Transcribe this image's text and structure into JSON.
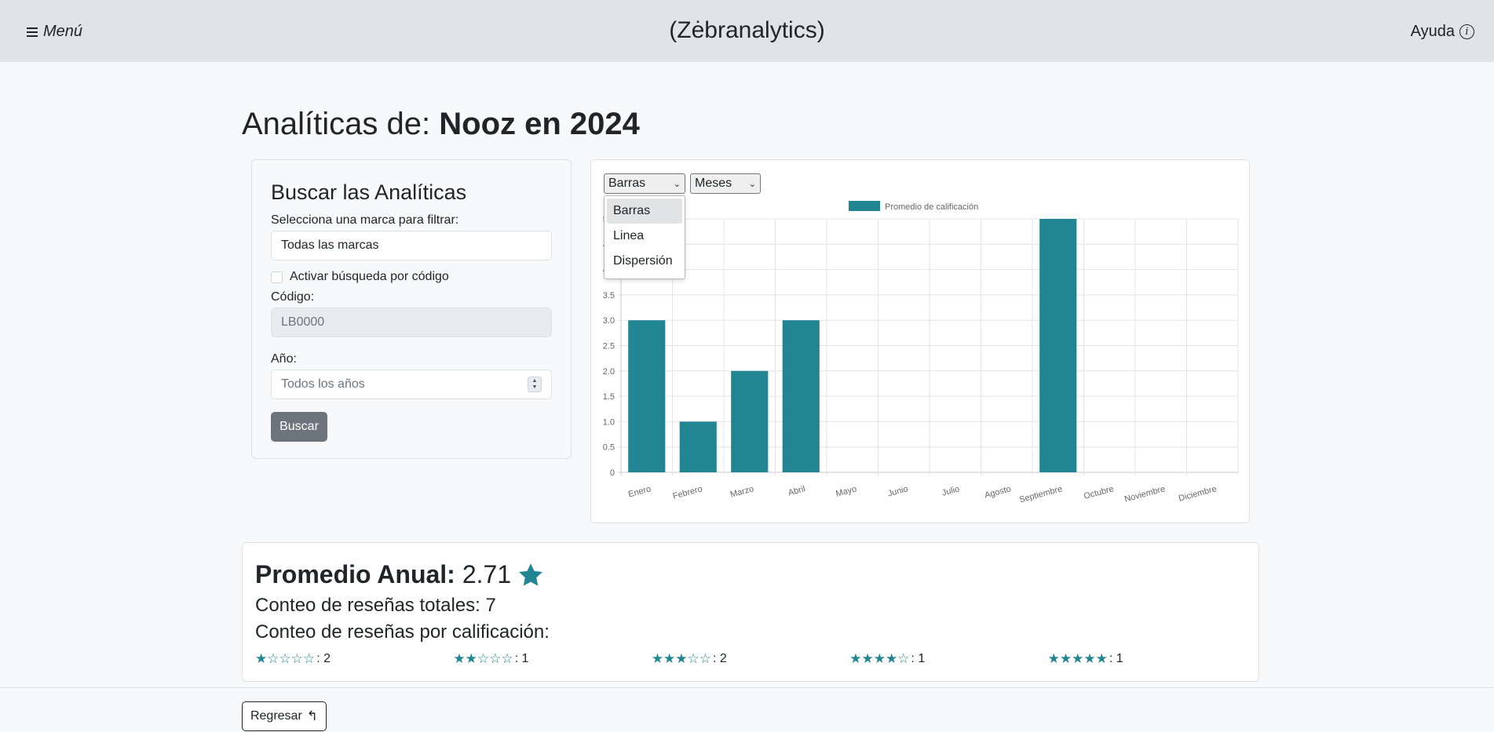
{
  "header": {
    "menu_label": "Menú",
    "brand": "(Zėbranalytics)",
    "help_label": "Ayuda"
  },
  "page": {
    "title_prefix": "Analíticas de: ",
    "title_bold": "Nooz en 2024"
  },
  "search": {
    "heading": "Buscar las Analíticas",
    "brand_label": "Selecciona una marca para filtrar:",
    "brand_value": "Todas las marcas",
    "code_search_label": "Activar búsqueda por código",
    "code_search_checked": false,
    "code_label": "Código:",
    "code_value": "LB0000",
    "year_label": "Año:",
    "year_placeholder": "Todos los años",
    "button_label": "Buscar"
  },
  "chart_controls": {
    "type_selected": "Barras",
    "type_options": [
      "Barras",
      "Linea",
      "Dispersión"
    ],
    "period_selected": "Meses"
  },
  "chart_data": {
    "type": "bar",
    "categories": [
      "Enero",
      "Febrero",
      "Marzo",
      "Abril",
      "Mayo",
      "Junio",
      "Julio",
      "Agosto",
      "Septiembre",
      "Octubre",
      "Noviembre",
      "Diciembre"
    ],
    "series": [
      {
        "name": "Promedio de calificación",
        "values": [
          3,
          1,
          2,
          3,
          0,
          0,
          0,
          0,
          5,
          0,
          0,
          0
        ],
        "color": "#218592"
      }
    ],
    "y_ticks": [
      "0",
      "0.5",
      "1.0",
      "1.5",
      "2.0",
      "2.5",
      "3.0",
      "3.5",
      "4.0",
      "4.5",
      "5.0"
    ],
    "ylim": [
      0,
      5
    ],
    "grid": true,
    "legend_position": "top-center"
  },
  "stats": {
    "annual_label": "Promedio Anual:",
    "annual_value": "2.71",
    "total_label": "Conteo de reseñas totales: 7",
    "by_rating_label": "Conteo de reseñas por calificación:",
    "ratings": [
      {
        "stars": 1,
        "count": ": 2"
      },
      {
        "stars": 2,
        "count": ": 1"
      },
      {
        "stars": 3,
        "count": ": 2"
      },
      {
        "stars": 4,
        "count": ": 1"
      },
      {
        "stars": 5,
        "count": ": 1"
      }
    ],
    "accent_color": "#218592"
  },
  "footer": {
    "back_label": "Regresar"
  }
}
